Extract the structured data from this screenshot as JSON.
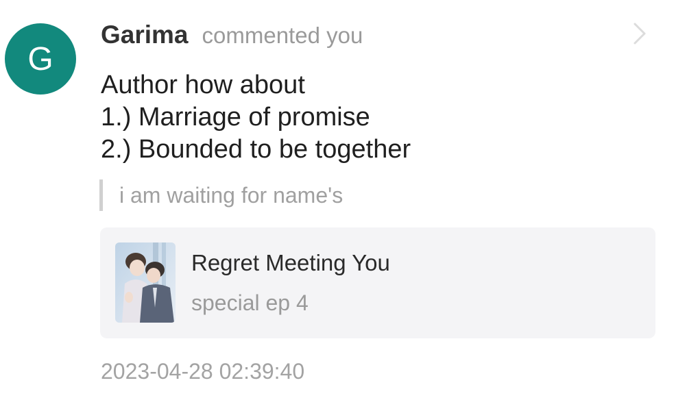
{
  "notification": {
    "avatar": {
      "initial": "G",
      "color": "#12897d"
    },
    "user": {
      "name": "Garima"
    },
    "action_text": "commented you",
    "chevron_icon": "chevron-right-icon",
    "comment": {
      "lines": [
        "Author how about",
        "1.) Marriage of promise",
        "2.) Bounded to be together"
      ]
    },
    "quote": {
      "text": "i am waiting for name's"
    },
    "book": {
      "title": "Regret Meeting You",
      "episode": "special ep 4",
      "cover_icon": "book-cover-image"
    },
    "timestamp": "2023-04-28 02:39:40"
  },
  "colors": {
    "avatar_bg": "#12897d",
    "card_bg": "#f4f4f6",
    "muted_text": "#9a9a9a",
    "quote_bar": "#d0d0d0"
  }
}
